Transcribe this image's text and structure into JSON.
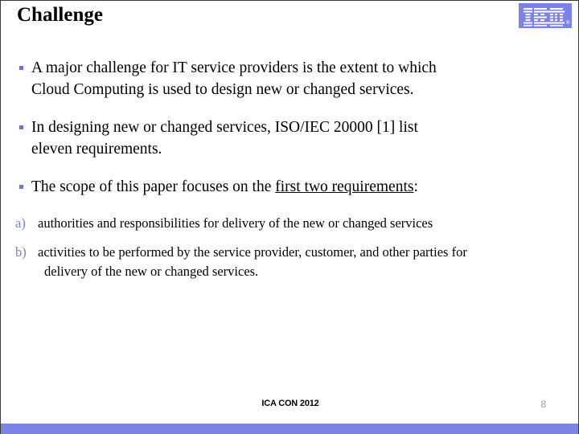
{
  "slide": {
    "title": "Challenge",
    "logo": {
      "name": "IBM",
      "registered_mark": "®",
      "background_color": "#7b84e6",
      "mark_color": "#ffffff"
    },
    "accent_color": "#7b84e6",
    "bullet_color": "#6b74d6",
    "sub_marker_color": "#7b84c8",
    "bullets": [
      {
        "marker": "bullet-square",
        "text": "A major challenge for IT service providers is the extent to which Cloud Computing is used to design new or changed services.",
        "line1": "A major challenge for IT service providers is the extent to which",
        "line2": "Cloud Computing is used to design new or changed services."
      },
      {
        "marker": "bullet-square",
        "text": "In designing new or changed services, ISO/IEC 20000 [1] list eleven requirements.",
        "line1": "In designing new or changed services, ISO/IEC 20000 [1] list",
        "line2": "eleven requirements."
      },
      {
        "marker": "bullet-square",
        "text": "The scope of this paper focuses on the first two requirements:",
        "prefix": "The scope of this paper focuses on the ",
        "underlined": "first two requirements",
        "suffix": ":"
      }
    ],
    "sub_items": [
      {
        "marker": "a)",
        "text": "authorities and responsibilities for delivery of the new or changed services",
        "line1": "authorities and responsibilities for delivery of the new or changed services",
        "line2": ""
      },
      {
        "marker": "b)",
        "text": "activities to be performed by the service provider, customer, and other parties for delivery of the new or changed services.",
        "line1": "activities to be performed by the service provider, customer, and other parties for",
        "line2": "delivery of the new or changed services."
      }
    ],
    "footer": {
      "conference": "ICA CON 2012",
      "page_number": "8"
    }
  }
}
